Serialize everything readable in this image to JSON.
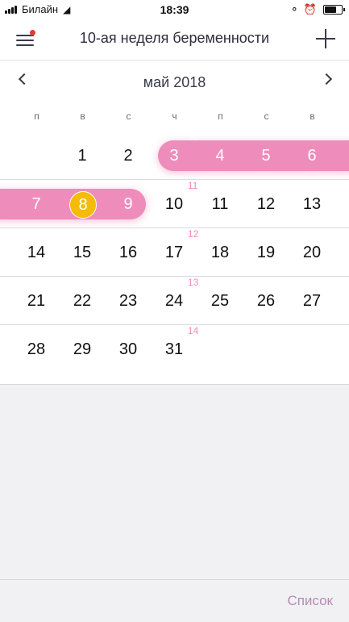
{
  "status_bar": {
    "carrier": "Билайн",
    "time": "18:39",
    "battery_level": 0.8
  },
  "header": {
    "title": "10-ая неделя беременности",
    "menu_badge_color": "#e53935"
  },
  "calendar": {
    "month_label": "май 2018",
    "weekdays": [
      "п",
      "в",
      "с",
      "ч",
      "п",
      "с",
      "в"
    ],
    "highlight_color": "#ee8cbb",
    "today_color": "#f6bb09",
    "today": "8",
    "weeks": [
      {
        "days": [
          "",
          "1",
          "2",
          "3",
          "4",
          "5",
          "6"
        ],
        "week_number": "10",
        "highlight": [
          3,
          4,
          5,
          6
        ]
      },
      {
        "days": [
          "7",
          "8",
          "9",
          "10",
          "11",
          "12",
          "13"
        ],
        "week_number": "11",
        "highlight": [
          0,
          1,
          2
        ]
      },
      {
        "days": [
          "14",
          "15",
          "16",
          "17",
          "18",
          "19",
          "20"
        ],
        "week_number": "12",
        "highlight": []
      },
      {
        "days": [
          "21",
          "22",
          "23",
          "24",
          "25",
          "26",
          "27"
        ],
        "week_number": "13",
        "highlight": []
      },
      {
        "days": [
          "28",
          "29",
          "30",
          "31",
          "",
          "",
          ""
        ],
        "week_number": "14",
        "highlight": []
      }
    ]
  },
  "bottom_bar": {
    "list_label": "Список"
  }
}
